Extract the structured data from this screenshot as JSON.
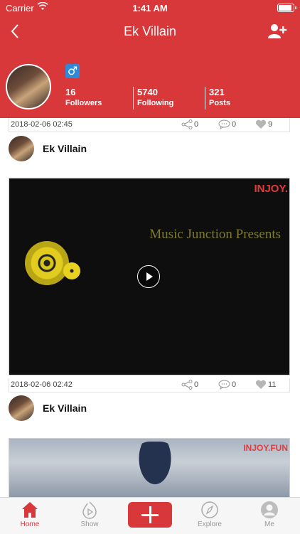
{
  "status_bar": {
    "carrier": "Carrier",
    "time": "1:41 AM"
  },
  "header": {
    "title": "Ek Villain"
  },
  "profile": {
    "gender_symbol": "♂",
    "stats": [
      {
        "value": "16",
        "label": "Followers"
      },
      {
        "value": "5740",
        "label": "Following"
      },
      {
        "value": "321",
        "label": "Posts"
      }
    ]
  },
  "posts": [
    {
      "date": "2018-02-06 02:45",
      "shares": "0",
      "comments": "0",
      "likes": "9",
      "author": "Ek Villain"
    },
    {
      "date": "2018-02-06 02:42",
      "shares": "0",
      "comments": "0",
      "likes": "11",
      "author": "Ek Villain",
      "video_title": "Music Junction Presents",
      "watermark": "INJOY."
    },
    {
      "watermark": "INJOY.FUN"
    }
  ],
  "tabbar": {
    "items": [
      {
        "label": "Home",
        "icon": "home-icon",
        "active": true
      },
      {
        "label": "Show",
        "icon": "play-flame-icon"
      },
      {
        "label": "",
        "icon": "plus-icon"
      },
      {
        "label": "Explore",
        "icon": "compass-icon"
      },
      {
        "label": "Me",
        "icon": "person-icon"
      }
    ]
  },
  "colors": {
    "accent": "#d9383b",
    "gender_badge": "#2e8ad8"
  }
}
